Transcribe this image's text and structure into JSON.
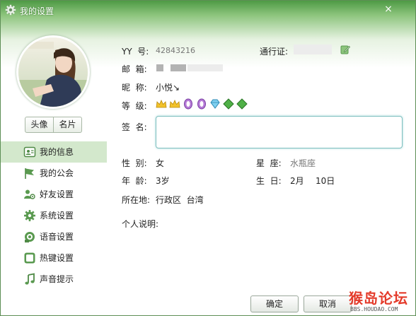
{
  "window": {
    "title": "我的设置",
    "close_icon": "×"
  },
  "left": {
    "segment": [
      "头像",
      "名片"
    ],
    "nav": [
      {
        "label": "我的信息",
        "icon": "id-card-icon",
        "active": true
      },
      {
        "label": "我的公会",
        "icon": "flag-icon"
      },
      {
        "label": "好友设置",
        "icon": "friends-icon"
      },
      {
        "label": "系统设置",
        "icon": "gear-icon"
      },
      {
        "label": "语音设置",
        "icon": "speaker-icon"
      },
      {
        "label": "热键设置",
        "icon": "keyboard-icon"
      },
      {
        "label": "声音提示",
        "icon": "music-note-icon"
      }
    ]
  },
  "info": {
    "yy_label": "YY  号:",
    "yy_value": "42843216",
    "pass_label": "通行证:",
    "email_label": "邮  箱:",
    "nick_label": "昵  称:",
    "nick_value": "小悦↘",
    "level_label": "等  级:",
    "sig_label": "签  名:",
    "gender_label": "性  别:",
    "gender_value": "女",
    "zodiac_label": "星  座:",
    "zodiac_value": "水瓶座",
    "age_label": "年  龄:",
    "age_value": "3岁",
    "birthday_label": "生  日:",
    "birthday_month": "2月",
    "birthday_day": "10日",
    "location_label": "所在地:",
    "location_value": "行政区  台湾",
    "desc_label": "个人说明:"
  },
  "buttons": {
    "ok": "确定",
    "cancel": "取消"
  },
  "watermark": {
    "brand": "猴岛论坛",
    "url": "BBS.HOUDAO.COM"
  },
  "colors": {
    "title_green": "#4e9a45",
    "nav_active": "#d3e8cc",
    "sig_border": "#7fbfbf",
    "watermark_red": "#e43b2b"
  }
}
